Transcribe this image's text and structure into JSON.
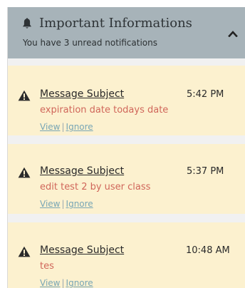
{
  "header": {
    "title": "Important Informations",
    "subtitle": "You have 3 unread notifications",
    "bell_icon": "bell-icon",
    "collapse_icon": "chevron-up-icon",
    "background_color": "#a7b3b9"
  },
  "colors": {
    "card_background": "#fcf1cf",
    "body_text": "#d0665a",
    "link": "#78a6b5"
  },
  "notifications": [
    {
      "icon": "warning-icon",
      "subject": "Message Subject",
      "time": "5:42 PM",
      "body": "expiration date todays date",
      "view_label": "View",
      "separator": "|",
      "ignore_label": "Ignore"
    },
    {
      "icon": "warning-icon",
      "subject": "Message Subject",
      "time": "5:37 PM",
      "body": "edit test 2 by user class",
      "view_label": "View",
      "separator": "|",
      "ignore_label": "Ignore"
    },
    {
      "icon": "warning-icon",
      "subject": "Message Subject",
      "time": "10:48 AM",
      "body": "tes",
      "view_label": "View",
      "separator": "|",
      "ignore_label": "Ignore"
    }
  ]
}
